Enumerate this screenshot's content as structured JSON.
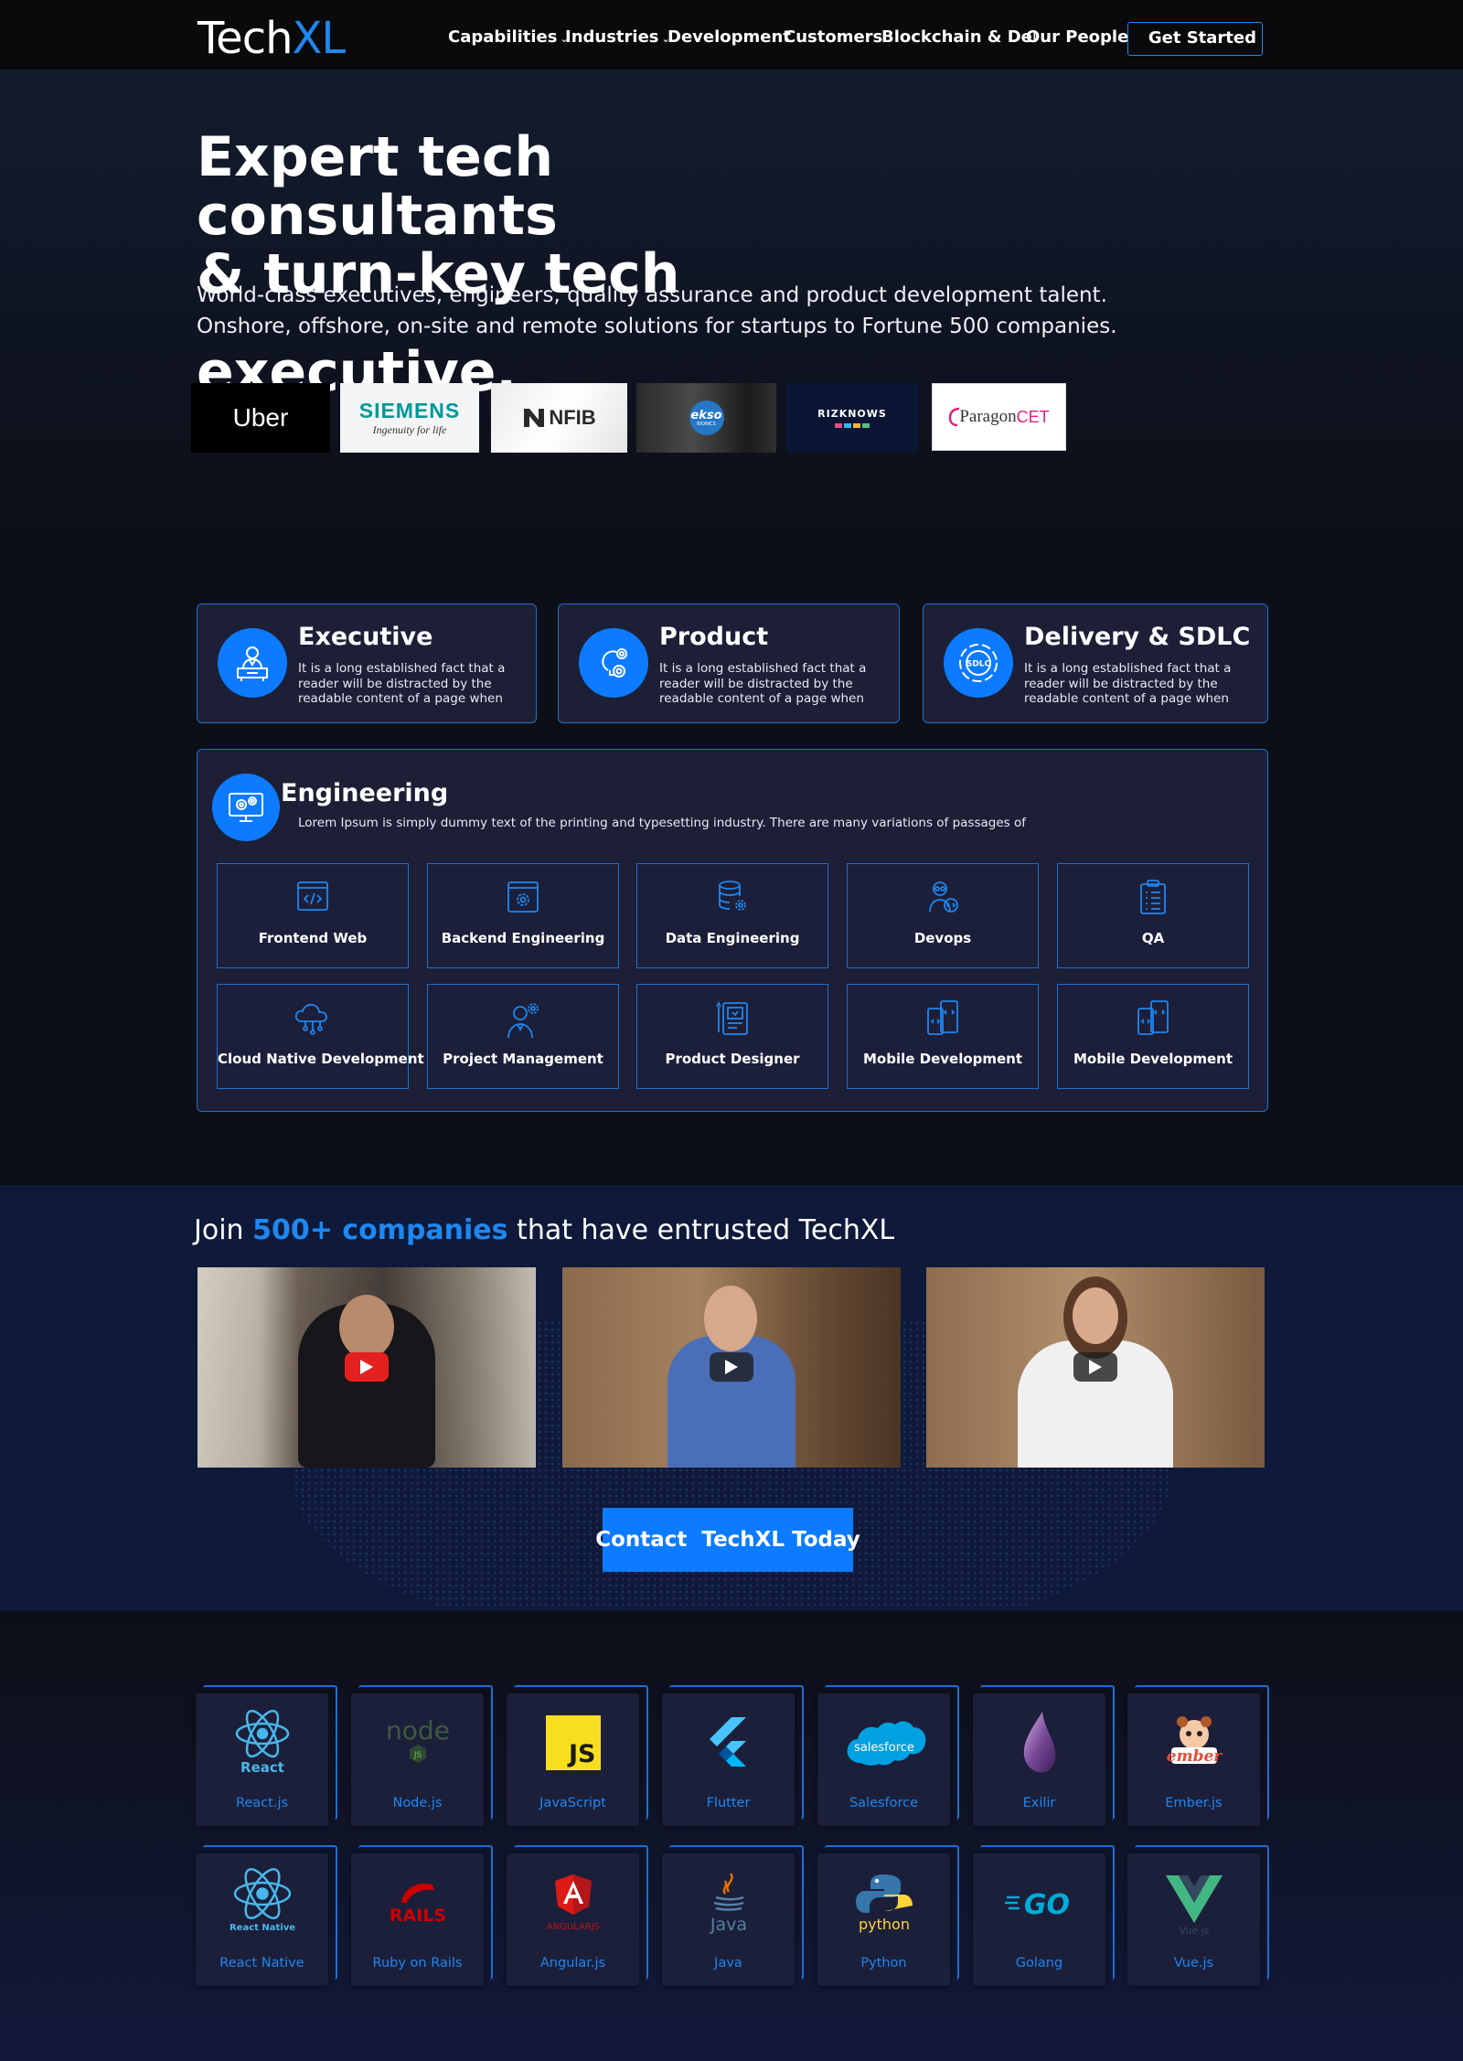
{
  "nav": {
    "logo_part1": "Tech",
    "logo_part2": "XL",
    "items": [
      {
        "label": "Capabilities",
        "caret": true
      },
      {
        "label": "Industries",
        "caret": true
      },
      {
        "label": "Development",
        "caret": false
      },
      {
        "label": "Customers",
        "caret": false
      },
      {
        "label": "Blockchain & DeFi",
        "caret": false
      },
      {
        "label": "Our People",
        "caret": false
      }
    ],
    "cta_label": "Get Started"
  },
  "hero": {
    "title_lines": [
      "Expert tech",
      "consultants",
      "& turn-key tech",
      "executive,"
    ],
    "subtitle_line1": "World-class executives, engineers, quality assurance and product development talent.",
    "subtitle_line2": "Onshore, offshore, on-site and remote solutions for startups to Fortune 500 companies.",
    "client_logos": [
      {
        "name": "Uber",
        "text": "Uber"
      },
      {
        "name": "Siemens",
        "text": "SIEMENS",
        "tagline": "Ingenuity for life"
      },
      {
        "name": "NFIB",
        "text": "NFIB"
      },
      {
        "name": "Ekso Bionics",
        "text": "ekso",
        "tagline": "BIONICS"
      },
      {
        "name": "Riz Knows",
        "text": "RIZKNOWS"
      },
      {
        "name": "ParagonCET",
        "text_a": "Paragon",
        "text_b": "CET"
      }
    ]
  },
  "capabilities": [
    {
      "title": "Executive",
      "text": "It is a long established fact that a reader will be distracted by the readable content of a page when",
      "icon": "executive-icon"
    },
    {
      "title": "Product",
      "text": "It is a long established fact that a reader will be distracted by the readable content of a page when",
      "icon": "product-icon"
    },
    {
      "title": "Delivery & SDLC",
      "text": "It is a long established fact that a reader will be distracted by the readable content of a page when",
      "icon": "sdlc-icon",
      "icon_text": "SDLC"
    }
  ],
  "engineering": {
    "title": "Engineering",
    "text": "Lorem Ipsum is simply dummy text of the printing and typesetting industry. There are many variations of passages of",
    "tiles": [
      {
        "label": "Frontend Web",
        "icon": "code-window-icon"
      },
      {
        "label": "Backend Engineering",
        "icon": "gear-window-icon"
      },
      {
        "label": "Data Engineering",
        "icon": "database-icon"
      },
      {
        "label": "Devops",
        "icon": "developer-icon"
      },
      {
        "label": "QA",
        "icon": "clipboard-icon"
      },
      {
        "label": "Cloud Native Development",
        "icon": "cloud-icon"
      },
      {
        "label": "Project Management",
        "icon": "manager-icon"
      },
      {
        "label": "Product Designer",
        "icon": "designer-icon"
      },
      {
        "label": "Mobile Development",
        "icon": "mobile-icon"
      },
      {
        "label": "Mobile Development",
        "icon": "mobile-icon"
      }
    ]
  },
  "testimonials": {
    "join_prefix": "Join ",
    "join_highlight": "500+ companies",
    "join_suffix": " that have entrusted TechXL",
    "cta_label": "Contact  TechXL Today"
  },
  "tech": [
    {
      "label": "React.js",
      "logo_text": "React"
    },
    {
      "label": "Node.js",
      "logo_text": "node"
    },
    {
      "label": "JavaScript",
      "logo_text": "JS"
    },
    {
      "label": "Flutter"
    },
    {
      "label": "Salesforce",
      "logo_text": "salesforce"
    },
    {
      "label": "Exilir"
    },
    {
      "label": "Ember.js",
      "logo_text": "ember"
    },
    {
      "label": "React Native",
      "logo_text": "React Native"
    },
    {
      "label": "Ruby on Rails",
      "logo_text": "RAILS"
    },
    {
      "label": "Angular.js",
      "logo_text": "ANGULARJS"
    },
    {
      "label": "Java",
      "logo_text": "Java"
    },
    {
      "label": "Python",
      "logo_text": "python"
    },
    {
      "label": "Golang",
      "logo_text": "GO"
    },
    {
      "label": "Vue.js",
      "logo_text": "Vue.js"
    }
  ],
  "colors": {
    "accent": "#1e87f0",
    "button": "#0d7bff",
    "card": "#1c1f36"
  }
}
